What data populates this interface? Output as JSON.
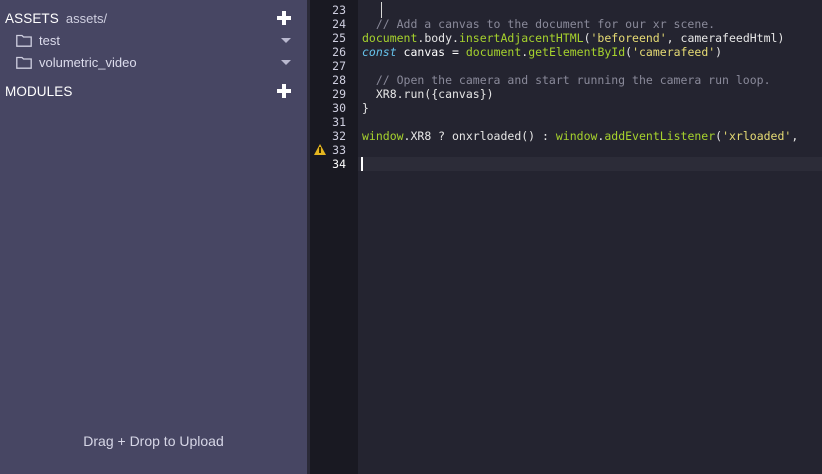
{
  "sidebar": {
    "assets": {
      "title": "ASSETS",
      "path": "assets/"
    },
    "folders": [
      {
        "label": "test"
      },
      {
        "label": "volumetric_video"
      }
    ],
    "modules": {
      "title": "MODULES"
    },
    "drop_text": "Drag + Drop to Upload"
  },
  "editor": {
    "line_numbers": [
      "23",
      "24",
      "25",
      "26",
      "27",
      "28",
      "29",
      "30",
      "31",
      "32",
      "33",
      "34"
    ],
    "warning_line": "33",
    "active_line": "34",
    "code": {
      "l24": "  // Add a canvas to the document for our xr scene.",
      "l25_a": "document",
      "l25_b": ".body.",
      "l25_c": "insertAdjacentHTML",
      "l25_d": "(",
      "l25_e": "'beforeend'",
      "l25_f": ", camerafeedHtml)",
      "l26_a": "const",
      "l26_b": " canvas = ",
      "l26_c": "document",
      "l26_d": ".",
      "l26_e": "getElementById",
      "l26_f": "(",
      "l26_g": "'camerafeed'",
      "l26_h": ")",
      "l28": "  // Open the camera and start running the camera run loop.",
      "l29": "  XR8.run({canvas})",
      "l30": "}",
      "l32_a": "window",
      "l32_b": ".XR8 ? onxrloaded() : ",
      "l32_c": "window",
      "l32_d": ".",
      "l32_e": "addEventListener",
      "l32_f": "(",
      "l32_g": "'xrloaded'",
      "l32_h": ","
    }
  },
  "colors": {
    "sidebar_bg": "#474663",
    "editor_bg": "#242430",
    "gutter_bg": "#191922",
    "comment": "#8a8a9a",
    "function": "#a6d22d",
    "string": "#e6db74",
    "keyword": "#66c2ea",
    "warning": "#e5b620"
  },
  "icons": {
    "add_asset": "plus-icon",
    "add_module": "plus-icon",
    "folder": "folder-icon",
    "expand": "chevron-down-icon",
    "warning": "warning-icon"
  }
}
